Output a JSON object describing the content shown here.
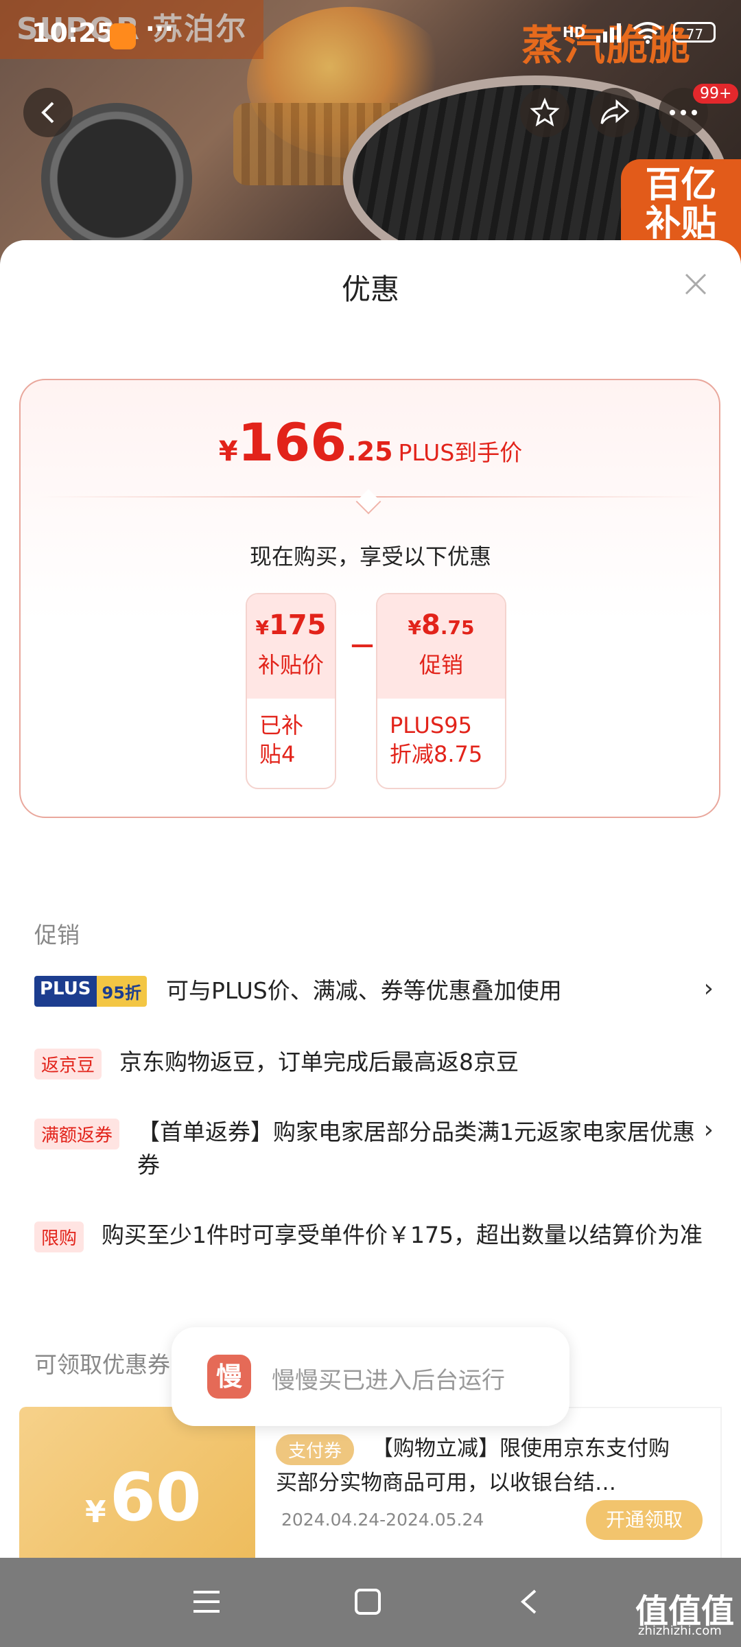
{
  "status_bar": {
    "time": "10:25",
    "dots": "···",
    "battery": "77",
    "hd_label": "HD"
  },
  "background": {
    "brand_left": "SUPOR 苏泊尔",
    "brand_right": "蒸汽脆脆",
    "subsidy_badge": "百亿\n补贴"
  },
  "top_actions": {
    "more_badge": "99+"
  },
  "sheet": {
    "title": "优惠",
    "price": {
      "currency": "¥",
      "integer": "166",
      "decimal": ".25",
      "label": "PLUS到手价"
    },
    "enjoy_text": "现在购买，享受以下优惠",
    "benefits": [
      {
        "currency": "¥",
        "amount": "175",
        "name": "补贴价",
        "desc": "已补贴4"
      },
      {
        "currency": "¥",
        "amount": "8",
        "amount_dec": ".75",
        "name": "促销",
        "desc": "PLUS95折减8.75"
      }
    ],
    "minus": "－"
  },
  "promotions": {
    "heading": "促销",
    "plus_tag": {
      "p1": "PLUS",
      "p2": "95折"
    },
    "rows": [
      {
        "text": "可与PLUS价、满减、券等优惠叠加使用"
      },
      {
        "tag": "返京豆",
        "text": "京东购物返豆，订单完成后最高返8京豆"
      },
      {
        "tag": "满额返券",
        "text": "【首单返券】购家电家居部分品类满1元返家电家居优惠券"
      },
      {
        "tag": "限购",
        "text": "购买至少1件时可享受单件价￥175，超出数量以结算价为准"
      }
    ],
    "chevron": "›"
  },
  "coupons": {
    "heading": "可领取优惠券",
    "item": {
      "currency": "¥",
      "amount": "60",
      "tag": "支付券",
      "desc": "【购物立减】限使用京东支付购买部分实物商品可用，以收银台结…",
      "date": "2024.04.24-2024.05.24",
      "claim": "开通领取"
    }
  },
  "toast": {
    "icon_text": "慢",
    "text": "慢慢买已进入后台运行"
  },
  "watermark": {
    "main": "值值值",
    "sub": "zhizhizhi.com"
  },
  "colors": {
    "accent_red": "#e2231a",
    "plus_blue": "#1c3d8f",
    "coupon_gold": "#eebc5c"
  }
}
